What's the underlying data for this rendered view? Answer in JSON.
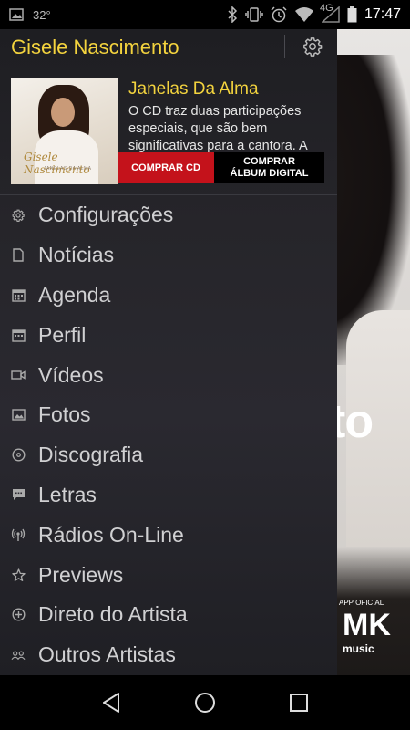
{
  "status_bar": {
    "temperature": "32°",
    "network": "4G",
    "time": "17:47",
    "icons": [
      "image-icon",
      "bluetooth-icon",
      "vibrate-icon",
      "alarm-icon",
      "wifi-icon",
      "signal-icon",
      "battery-icon"
    ]
  },
  "drawer": {
    "title": "Gisele Nascimento",
    "settings_icon": "gear-icon",
    "album": {
      "cover_script": "Gisele Nascimento",
      "cover_subtitle": "JANELAS DA ALMA",
      "title": "Janelas Da Alma",
      "description": "O CD traz duas participações especiais, que são bem significativas para a cantora. A",
      "buy_cd_label": "COMPRAR CD",
      "buy_digital_line1": "COMPRAR",
      "buy_digital_line2": "ÁLBUM DIGITAL"
    },
    "menu": [
      {
        "label": "Configurações",
        "icon": "gear-icon"
      },
      {
        "label": "Notícias",
        "icon": "document-icon"
      },
      {
        "label": "Agenda",
        "icon": "calendar-icon"
      },
      {
        "label": "Perfil",
        "icon": "profile-calendar-icon"
      },
      {
        "label": "Vídeos",
        "icon": "video-camera-icon"
      },
      {
        "label": "Fotos",
        "icon": "photo-icon"
      },
      {
        "label": "Discografia",
        "icon": "disc-icon"
      },
      {
        "label": "Letras",
        "icon": "chat-bubble-icon"
      },
      {
        "label": "Rádios On-Line",
        "icon": "radio-broadcast-icon"
      },
      {
        "label": "Previews",
        "icon": "star-icon"
      },
      {
        "label": "Direto do Artista",
        "icon": "plus-circle-icon"
      },
      {
        "label": "Outros Artistas",
        "icon": "group-icon"
      }
    ]
  },
  "background": {
    "title_fragment": "to",
    "brand_small": "APP OFICIAL",
    "brand": "MK",
    "brand_sub": "music"
  },
  "colors": {
    "accent": "#f3d33e",
    "buy_button": "#c4121b"
  }
}
